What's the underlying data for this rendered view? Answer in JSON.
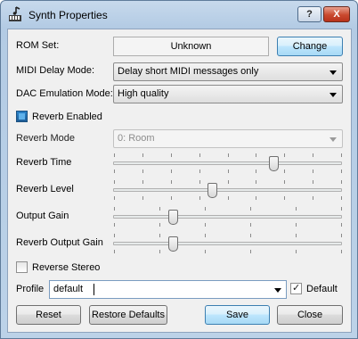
{
  "window": {
    "title": "Synth Properties",
    "help_button": "?",
    "close_button": "X",
    "accent_color": "#3c7fb1"
  },
  "rom": {
    "label": "ROM Set:",
    "value": "Unknown",
    "change_button": "Change"
  },
  "midi_delay": {
    "label": "MIDI Delay Mode:",
    "value": "Delay short MIDI messages only"
  },
  "dac_emulation": {
    "label": "DAC Emulation Mode:",
    "value": "High quality"
  },
  "reverb_enabled": {
    "label": "Reverb Enabled",
    "checked": true
  },
  "reverb_mode": {
    "label": "Reverb Mode",
    "value": "0: Room",
    "enabled": false
  },
  "sliders": {
    "reverb_time": {
      "label": "Reverb Time",
      "fraction": 0.7
    },
    "reverb_level": {
      "label": "Reverb Level",
      "fraction": 0.43
    },
    "output_gain": {
      "label": "Output Gain",
      "fraction": 0.26
    },
    "reverb_output_gain": {
      "label": "Reverb Output Gain",
      "fraction": 0.26
    }
  },
  "reverse_stereo": {
    "label": "Reverse Stereo",
    "checked": false
  },
  "profile": {
    "label": "Profile",
    "value": "default",
    "default_label": "Default",
    "default_checked": true
  },
  "buttons": {
    "reset": "Reset",
    "restore_defaults": "Restore Defaults",
    "save": "Save",
    "close": "Close"
  }
}
